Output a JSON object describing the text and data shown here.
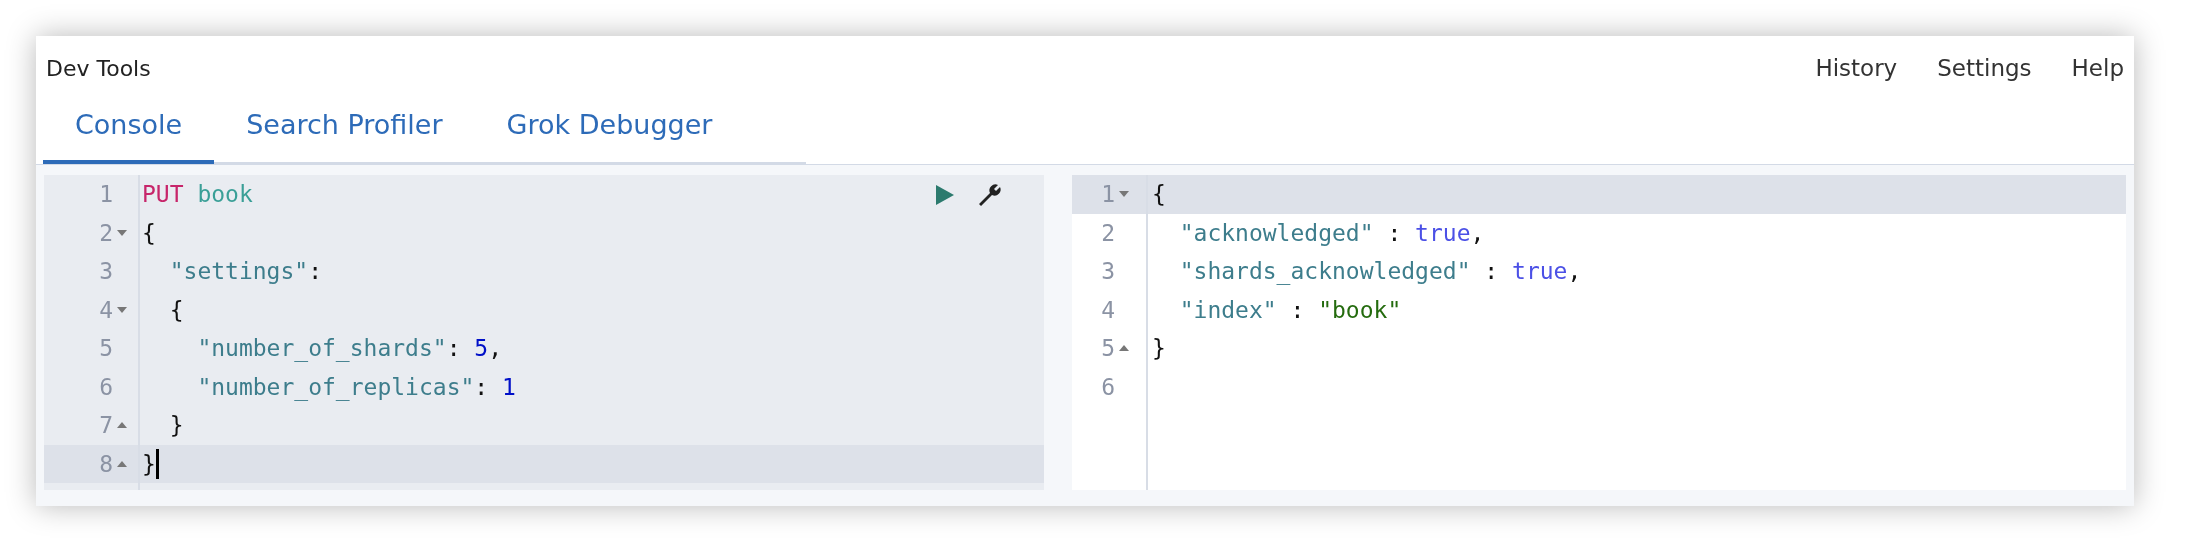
{
  "window": {
    "title": "Dev Tools"
  },
  "top_links": [
    "History",
    "Settings",
    "Help"
  ],
  "tabs": [
    {
      "label": "Console",
      "selected": true
    },
    {
      "label": "Search Profiler",
      "selected": false
    },
    {
      "label": "Grok Debugger",
      "selected": false
    }
  ],
  "request_editor": {
    "lines": [
      {
        "number": "1",
        "fold_start": false,
        "fold_end": false,
        "active": false,
        "cursor": false,
        "tokens": [
          {
            "kind": "method",
            "text": "PUT"
          },
          {
            "kind": "url",
            "text": " book"
          }
        ]
      },
      {
        "number": "2",
        "fold_start": true,
        "fold_end": false,
        "active": false,
        "cursor": false,
        "tokens": [
          {
            "kind": "punct",
            "text": "{"
          }
        ]
      },
      {
        "number": "3",
        "fold_start": false,
        "fold_end": false,
        "active": false,
        "cursor": false,
        "tokens": [
          {
            "kind": "key",
            "text": "  \"settings\""
          },
          {
            "kind": "punct",
            "text": ":"
          }
        ]
      },
      {
        "number": "4",
        "fold_start": true,
        "fold_end": false,
        "active": false,
        "cursor": false,
        "tokens": [
          {
            "kind": "punct",
            "text": "  {"
          }
        ]
      },
      {
        "number": "5",
        "fold_start": false,
        "fold_end": false,
        "active": false,
        "cursor": false,
        "tokens": [
          {
            "kind": "key",
            "text": "    \"number_of_shards\""
          },
          {
            "kind": "punct",
            "text": ":"
          },
          {
            "kind": "number",
            "text": " 5"
          },
          {
            "kind": "punct",
            "text": ","
          }
        ]
      },
      {
        "number": "6",
        "fold_start": false,
        "fold_end": false,
        "active": false,
        "cursor": false,
        "tokens": [
          {
            "kind": "key",
            "text": "    \"number_of_replicas\""
          },
          {
            "kind": "punct",
            "text": ":"
          },
          {
            "kind": "number",
            "text": " 1"
          }
        ]
      },
      {
        "number": "7",
        "fold_start": false,
        "fold_end": true,
        "active": false,
        "cursor": false,
        "tokens": [
          {
            "kind": "punct",
            "text": "  }"
          }
        ]
      },
      {
        "number": "8",
        "fold_start": false,
        "fold_end": true,
        "active": true,
        "cursor": true,
        "tokens": [
          {
            "kind": "punct",
            "text": "}"
          }
        ]
      }
    ]
  },
  "response_editor": {
    "lines": [
      {
        "number": "1",
        "fold_start": true,
        "fold_end": false,
        "active": true,
        "tokens": [
          {
            "kind": "punct",
            "text": "{"
          }
        ]
      },
      {
        "number": "2",
        "fold_start": false,
        "fold_end": false,
        "active": false,
        "tokens": [
          {
            "kind": "key",
            "text": "  \"acknowledged\""
          },
          {
            "kind": "punct",
            "text": " : "
          },
          {
            "kind": "boolean",
            "text": "true"
          },
          {
            "kind": "punct",
            "text": ","
          }
        ]
      },
      {
        "number": "3",
        "fold_start": false,
        "fold_end": false,
        "active": false,
        "tokens": [
          {
            "kind": "key",
            "text": "  \"shards_acknowledged\""
          },
          {
            "kind": "punct",
            "text": " : "
          },
          {
            "kind": "boolean",
            "text": "true"
          },
          {
            "kind": "punct",
            "text": ","
          }
        ]
      },
      {
        "number": "4",
        "fold_start": false,
        "fold_end": false,
        "active": false,
        "tokens": [
          {
            "kind": "key",
            "text": "  \"index\""
          },
          {
            "kind": "punct",
            "text": " : "
          },
          {
            "kind": "string",
            "text": "\"book\""
          }
        ]
      },
      {
        "number": "5",
        "fold_start": false,
        "fold_end": true,
        "active": false,
        "tokens": [
          {
            "kind": "punct",
            "text": "}"
          }
        ]
      },
      {
        "number": "6",
        "fold_start": false,
        "fold_end": false,
        "active": false
      }
    ]
  }
}
